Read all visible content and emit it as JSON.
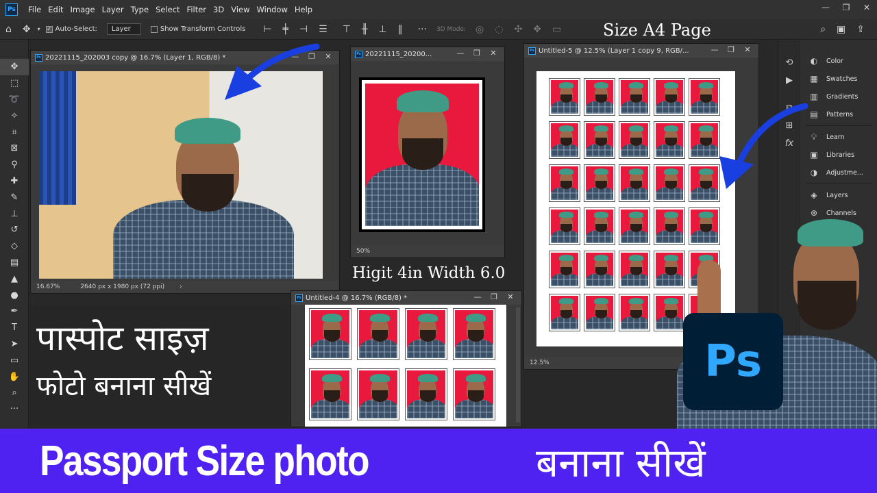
{
  "menu": [
    "File",
    "Edit",
    "Image",
    "Layer",
    "Type",
    "Select",
    "Filter",
    "3D",
    "View",
    "Window",
    "Help"
  ],
  "options": {
    "auto_select": "Auto-Select:",
    "layer_select": "Layer",
    "show_transform": "Show Transform Controls",
    "mode_3d": "3D Mode:"
  },
  "panel": {
    "items": [
      "Color",
      "Swatches",
      "Gradients",
      "Patterns",
      "Learn",
      "Libraries",
      "Adjustme...",
      "Layers",
      "Channels"
    ]
  },
  "docs": {
    "doc1": {
      "title": "20221115_202003 copy @ 16.7% (Layer 1, RGB/8) *",
      "zoom": "16.67%",
      "dimensions": "2640 px x 1980 px (72 ppi)"
    },
    "doc2": {
      "title": "20221115_20200...",
      "zoom": "50%"
    },
    "doc3": {
      "title": "Untitled-5 @ 12.5% (Layer 1 copy 9, RGB/...",
      "zoom": "12.5%"
    },
    "doc4": {
      "title": "Untitled-4 @ 16.7% (RGB/8) *"
    }
  },
  "overlay": {
    "size_label": "Size A4 Page",
    "dims_label": "Higit 4in Width 6.0",
    "hindi_line1": "पास्पोट साइज़",
    "hindi_line2": "फोटो बनाना सीखें"
  },
  "ps_logo": "Ps",
  "banner": {
    "english": "Passport Size photo",
    "hindi": "बनाना सीखें"
  },
  "colors": {
    "photo_background": "#e8193c",
    "banner": "#4f22f2",
    "arrow": "#1a3fe0",
    "ps_blue": "#31a8ff"
  }
}
